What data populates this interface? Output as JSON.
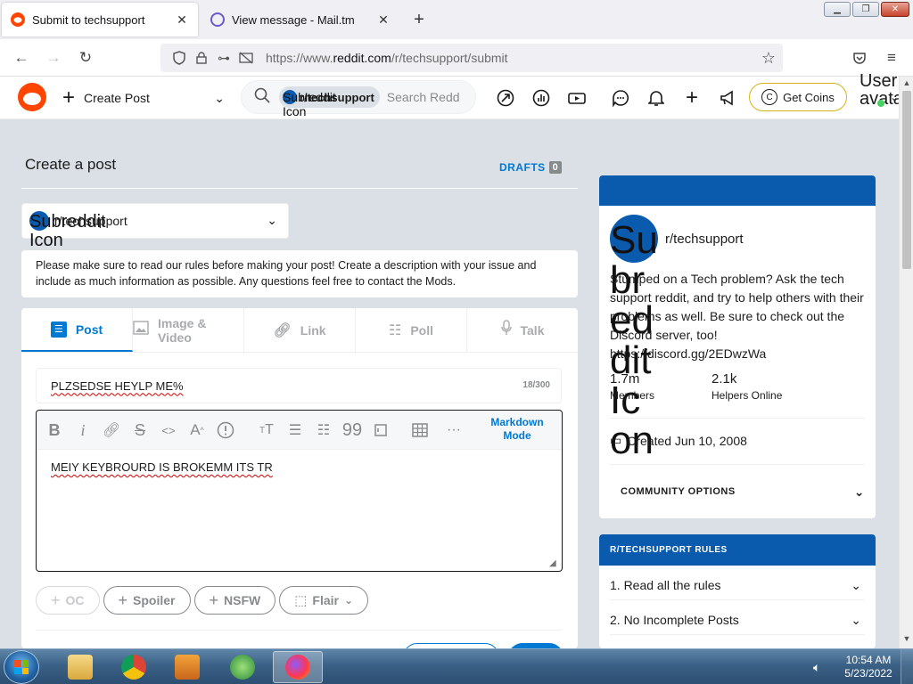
{
  "browser": {
    "tabs": [
      {
        "title": "Submit to techsupport",
        "favicon": "reddit-icon",
        "active": true
      },
      {
        "title": "View message - Mail.tm",
        "favicon": "mail-icon",
        "active": false
      }
    ],
    "url_prefix": "https://www.",
    "url_domain": "reddit.com",
    "url_path": "/r/techsupport/submit"
  },
  "header": {
    "create_post": "Create Post",
    "search_chip_alt": "Subreddit Icon",
    "search_chip": "r/techsupport",
    "search_placeholder": "Search Reddit",
    "get_coins": "Get Coins",
    "user_alt": "User avatar"
  },
  "main": {
    "title": "Create a post",
    "drafts_label": "DRAFTS",
    "drafts_count": "0",
    "community_alt": "Subreddit Icon",
    "community": "r/techsupport",
    "notice": "Please make sure to read our rules before making your post! Create a description with your issue and include as much information as possible. Any questions feel free to contact the Mods.",
    "tabs": [
      "Post",
      "Image & Video",
      "Link",
      "Poll",
      "Talk"
    ],
    "post_title": "PLZSEDSE HEYLP ME%",
    "title_count": "18/300",
    "markdown_mode": "Markdown Mode",
    "body": "MEIY KEYBROURD IS BROKEMM ITS TR",
    "tags": [
      "OC",
      "Spoiler",
      "NSFW",
      "Flair"
    ]
  },
  "sidebar": {
    "icon_alt": "Subreddit Icon",
    "name": "r/techsupport",
    "description": "Stumped on a Tech problem? Ask the tech support reddit, and try to help others with their problems as well. Be sure to check out the Discord server, too! https://discord.gg/2EDwzWa",
    "members_value": "1.7m",
    "members_label": "Members",
    "online_value": "2.1k",
    "online_label": "Helpers Online",
    "created": "Created Jun 10, 2008",
    "community_options": "COMMUNITY OPTIONS",
    "rules_title": "R/TECHSUPPORT RULES",
    "rules": [
      "1. Read all the rules",
      "2. No Incomplete Posts"
    ]
  },
  "taskbar": {
    "time": "10:54 AM",
    "date": "5/23/2022"
  },
  "colors": {
    "reddit_orange": "#ff4500",
    "reddit_blue": "#0079d3",
    "community_band": "#0a5bae"
  }
}
